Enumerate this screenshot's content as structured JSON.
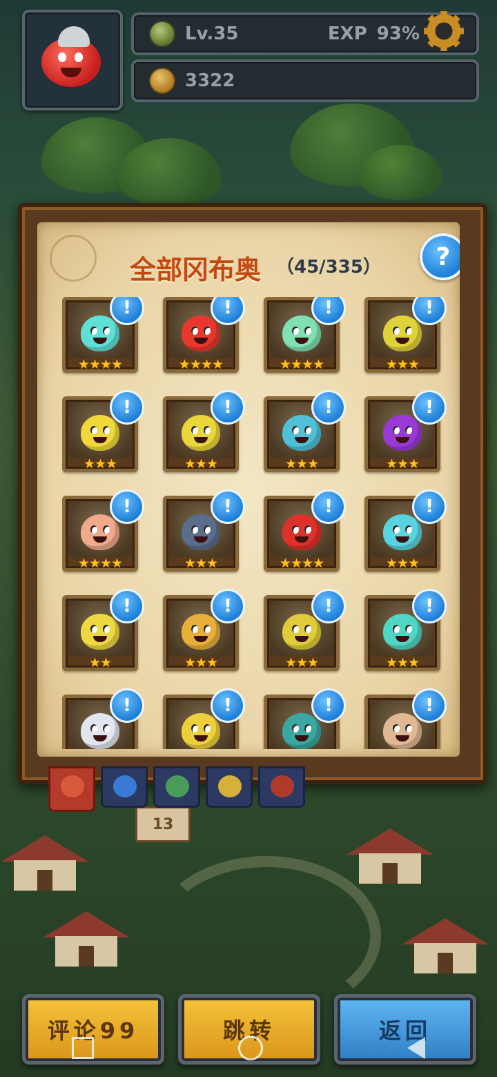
{
  "header": {
    "level": "Lv.35",
    "exp_label": "EXP",
    "exp_percent": "93%",
    "gold": "3322"
  },
  "collection": {
    "title": "全部冈布奥",
    "count": "（45/335）",
    "help_icon": "?",
    "info_icon": "!",
    "cards": [
      {
        "name": "monster-cyan-knight",
        "color": "#5fe0d6",
        "stars": "★★★★"
      },
      {
        "name": "monster-red-knight",
        "color": "#e8382e",
        "stars": "★★★★"
      },
      {
        "name": "monster-mint-bishop",
        "color": "#7fe0b4",
        "stars": "★★★★"
      },
      {
        "name": "monster-yellow-ranger",
        "color": "#e0d23a",
        "stars": "★★★"
      },
      {
        "name": "monster-yellow-spartan",
        "color": "#f0d83a",
        "stars": "★★★"
      },
      {
        "name": "monster-yellow-warrior",
        "color": "#e8d63a",
        "stars": "★★★"
      },
      {
        "name": "monster-cyan-pirate",
        "color": "#4fc0d6",
        "stars": "★★★"
      },
      {
        "name": "monster-purple-bat",
        "color": "#9a3ad6",
        "stars": "★★★"
      },
      {
        "name": "monster-pink-lion",
        "color": "#f0a98a",
        "stars": "★★★★"
      },
      {
        "name": "monster-dark-reaper",
        "color": "#5a6e8c",
        "stars": "★★★"
      },
      {
        "name": "monster-red-demon",
        "color": "#e0302a",
        "stars": "★★★★"
      },
      {
        "name": "monster-cyan-alchemist",
        "color": "#58d4e0",
        "stars": "★★★"
      },
      {
        "name": "monster-yellow-witch",
        "color": "#ecd840",
        "stars": "★★"
      },
      {
        "name": "monster-orange-monkey",
        "color": "#e8b03a",
        "stars": "★★★"
      },
      {
        "name": "monster-yellow-gentleman",
        "color": "#e0cc3a",
        "stars": "★★★"
      },
      {
        "name": "monster-teal-queen",
        "color": "#4fd6c4",
        "stars": "★★★"
      },
      {
        "name": "monster-white-angel",
        "color": "#e0e6f0",
        "stars": ""
      },
      {
        "name": "monster-yellow-clown",
        "color": "#ecd03a",
        "stars": ""
      },
      {
        "name": "monster-teal-magician",
        "color": "#3aa8a0",
        "stars": ""
      },
      {
        "name": "monster-tan-bunny",
        "color": "#e0b894",
        "stars": ""
      }
    ]
  },
  "tabs": [
    {
      "name": "tab-all",
      "color": "#d85a3a",
      "active": true
    },
    {
      "name": "tab-blue",
      "color": "#3a7ad6",
      "active": false
    },
    {
      "name": "tab-green",
      "color": "#4a9a5a",
      "active": false
    },
    {
      "name": "tab-gold",
      "color": "#d6b03a",
      "active": false
    },
    {
      "name": "tab-red",
      "color": "#b03a2a",
      "active": false
    }
  ],
  "scene": {
    "signpost": "13"
  },
  "buttons": {
    "comments": "评论99",
    "jump": "跳转",
    "back": "返回"
  }
}
